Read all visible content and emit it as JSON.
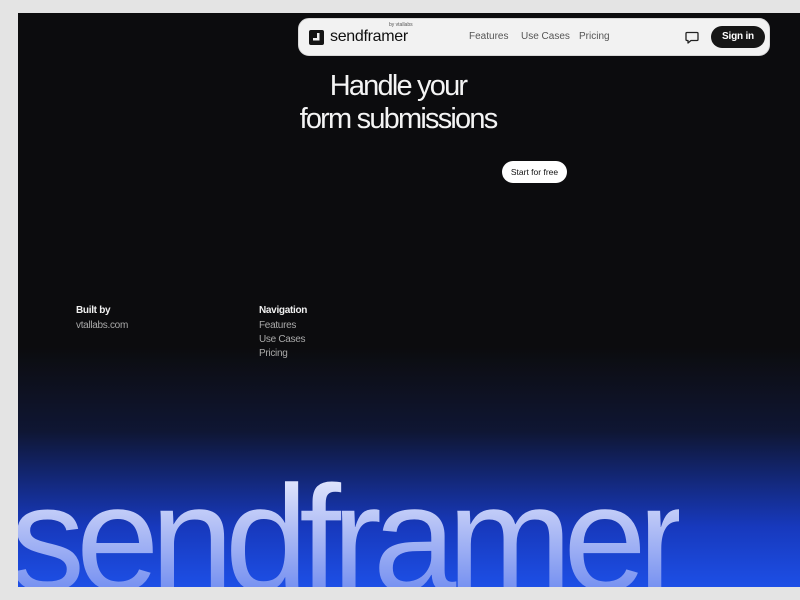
{
  "nav": {
    "logo_text": "sendframer",
    "logo_tag": "by vtallabs",
    "links": [
      "Features",
      "Use Cases",
      "Pricing"
    ],
    "chat_icon": "chat-bubble-icon",
    "signin_label": "Sign in"
  },
  "hero": {
    "title_line1": "Handle your",
    "title_line2": "form submissions",
    "cta_label": "Start for free"
  },
  "footer": {
    "built_by_heading": "Built by",
    "built_by_link": "vtallabs.com",
    "navigation_heading": "Navigation",
    "navigation_links": [
      "Features",
      "Use Cases",
      "Pricing"
    ]
  },
  "big_wordmark": "sendframer",
  "colors": {
    "background": "#0c0c0e",
    "accent_blue": "#1d4fe6",
    "navbar": "#f2f2f2",
    "button_dark": "#161616"
  }
}
